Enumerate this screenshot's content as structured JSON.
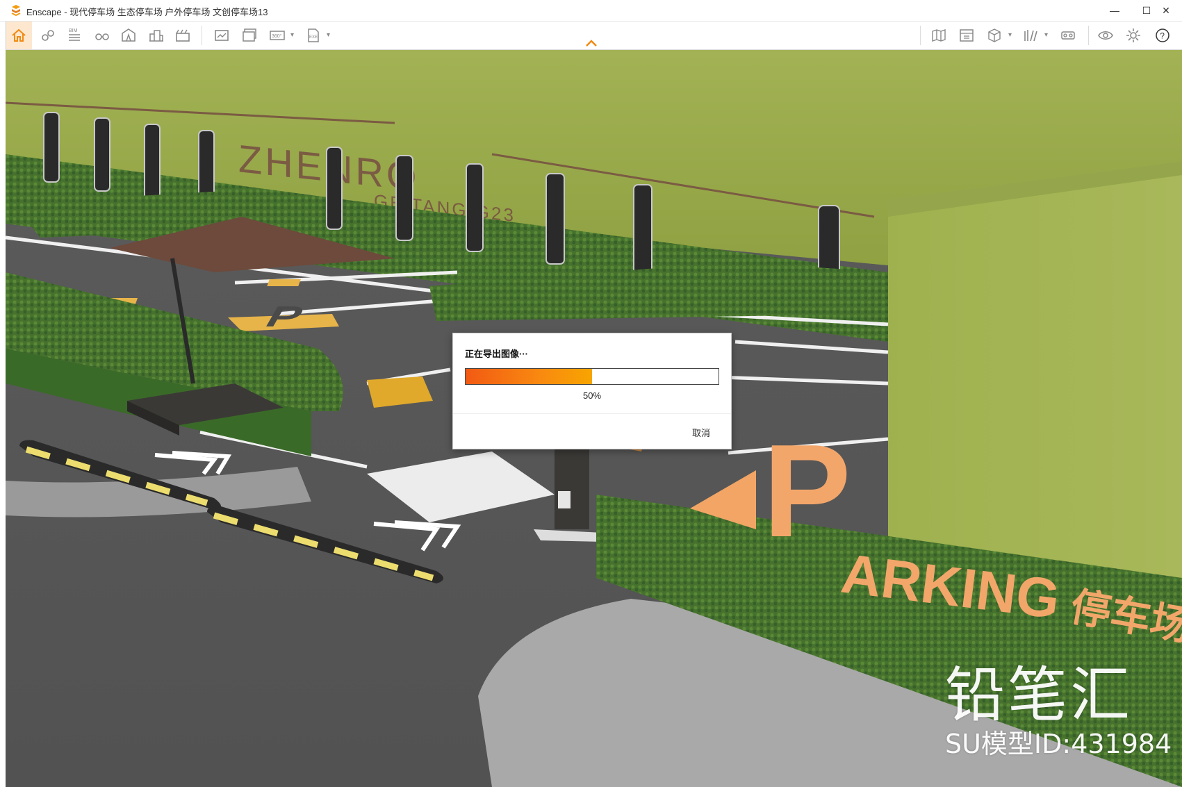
{
  "window": {
    "title": "Enscape - 现代停车场 生态停车场 户外停车场 文创停车场13",
    "controls": {
      "minimize": "—",
      "maximize": "☐",
      "close": "✕"
    }
  },
  "toolbar": {
    "bim_label": "BIM",
    "panorama_label": "360°",
    "exe_label": "EXE",
    "help_label": "?"
  },
  "scene": {
    "sign_brand": "ZHENRO",
    "sign_sub": "GE TANG G23",
    "parking_letter": "P",
    "parking_word": "ARKING",
    "parking_cn": "停车场",
    "ground_letter": "P"
  },
  "dialog": {
    "title": "正在导出图像···",
    "progress_fraction": 0.5,
    "progress_text": "50%",
    "cancel_label": "取消"
  },
  "watermark": {
    "brand": "铅笔汇",
    "model_id": "SU模型ID:431984"
  },
  "colors": {
    "accent": "#f28a12",
    "progress_start": "#f25a13",
    "progress_end": "#f7a500"
  }
}
